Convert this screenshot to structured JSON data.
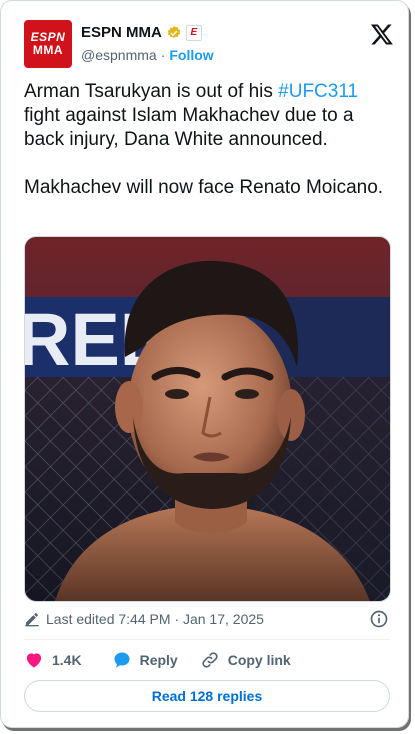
{
  "account": {
    "avatar_line1": "ESPN",
    "avatar_line2": "MMA",
    "name": "ESPN MMA",
    "badge_letter": "E",
    "handle": "@espnmma",
    "separator": "·",
    "follow_label": "Follow"
  },
  "tweet": {
    "line1_before": "Arman Tsarukyan is out of his ",
    "hashtag": "#UFC311",
    "line1_after": " fight against Islam Makhachev due to a back injury, Dana White announced.",
    "paragraph2": "Makhachev will now face Renato Moicano."
  },
  "meta": {
    "edited_text": "Last edited 7:44 PM · Jan 17, 2025"
  },
  "actions": {
    "like_count": "1.4K",
    "reply_label": "Reply",
    "copy_label": "Copy link"
  },
  "read_replies_label": "Read 128 replies",
  "photo": {
    "banner_text": "REE"
  },
  "colors": {
    "accent": "#1d9bf0",
    "like": "#f91880",
    "brand": "#d0121a"
  }
}
